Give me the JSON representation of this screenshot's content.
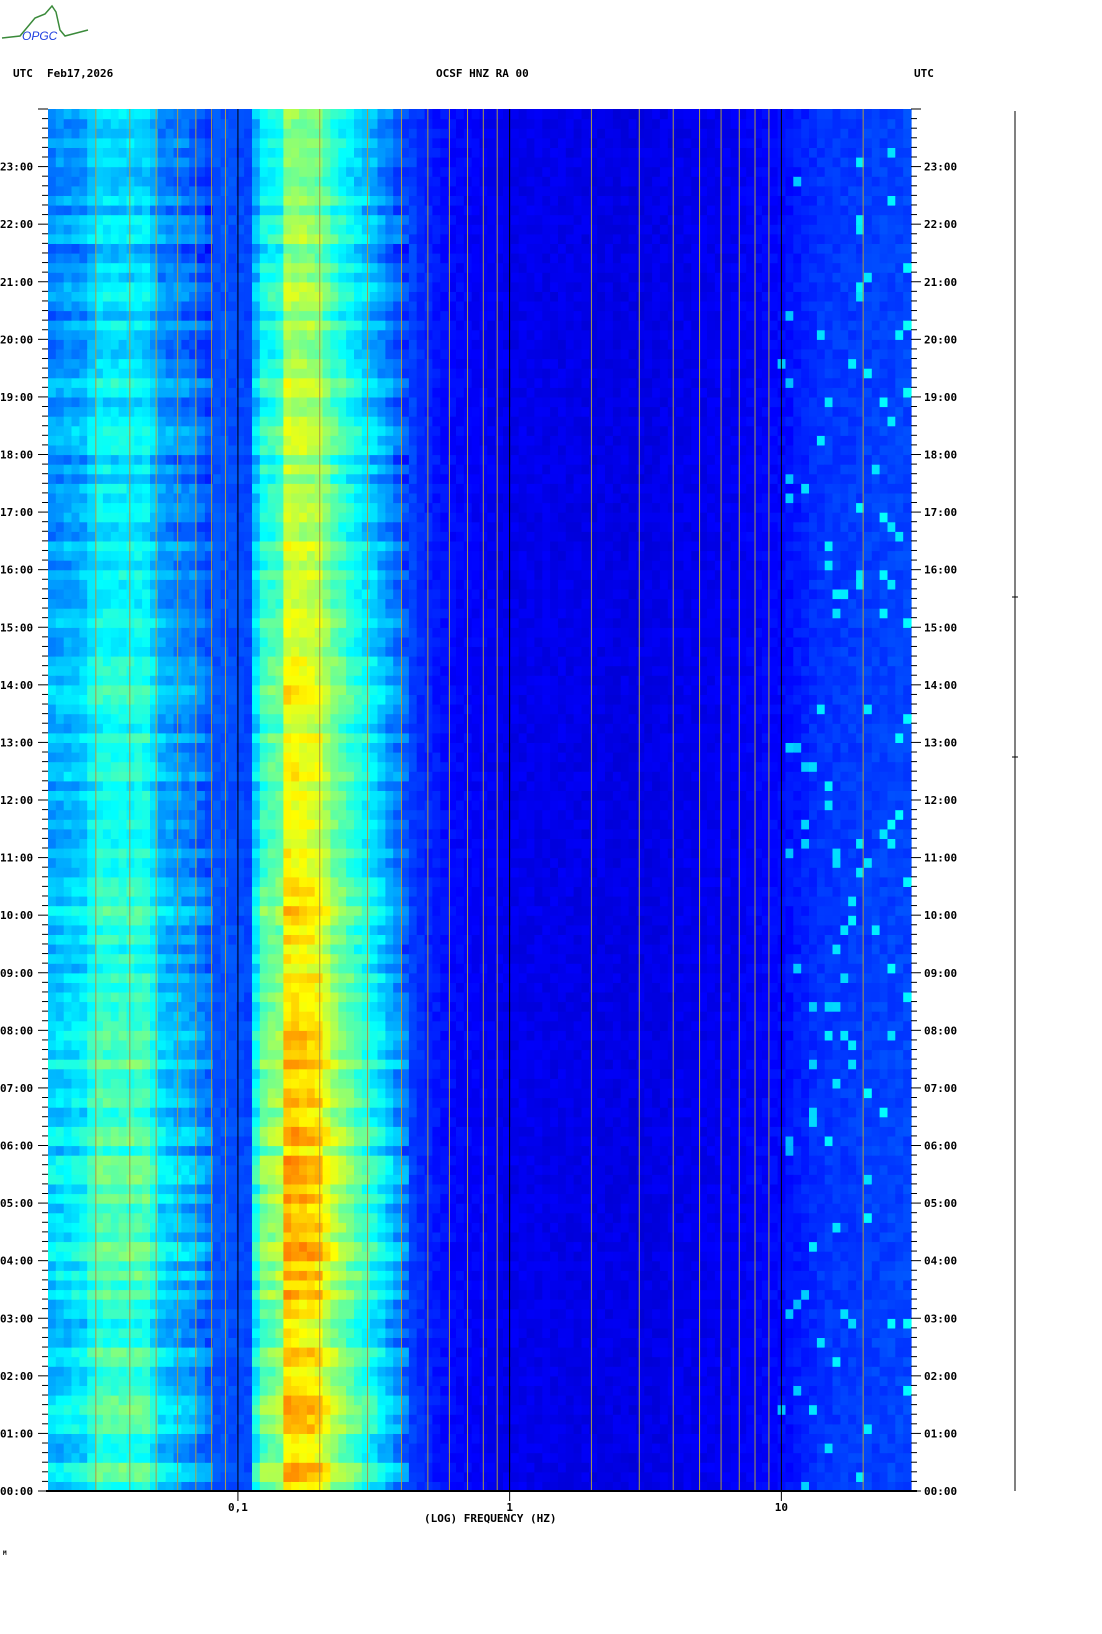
{
  "header": {
    "left_tz": "UTC",
    "date": "Feb17,2026",
    "station": "OCSF HNZ RA 00",
    "right_tz": "UTC",
    "logo_text": "OPGC"
  },
  "footer_mark": "M",
  "chart_data": {
    "type": "heatmap",
    "title": "OCSF HNZ RA 00",
    "xlabel": "(LOG) FREQUENCY (HZ)",
    "ylabel": "UTC",
    "x_scale": "log",
    "xlim": [
      0.02,
      30
    ],
    "x_ticks": [
      {
        "value": 0.1,
        "label": "0,1"
      },
      {
        "value": 1,
        "label": "1"
      },
      {
        "value": 10,
        "label": "10"
      }
    ],
    "ylim": [
      0,
      24
    ],
    "y_ticks": [
      "00:00",
      "01:00",
      "02:00",
      "03:00",
      "04:00",
      "05:00",
      "06:00",
      "07:00",
      "08:00",
      "09:00",
      "10:00",
      "11:00",
      "12:00",
      "13:00",
      "14:00",
      "15:00",
      "16:00",
      "17:00",
      "18:00",
      "19:00",
      "20:00",
      "21:00",
      "22:00",
      "23:00"
    ],
    "grid": true,
    "colormap": [
      "#00008c",
      "#0000ff",
      "#0080ff",
      "#00ffff",
      "#80ff80",
      "#ffff00",
      "#ff8000",
      "#ff0000"
    ],
    "band_profile": [
      [
        0.02,
        0.34
      ],
      [
        0.027,
        0.38
      ],
      [
        0.03,
        0.46
      ],
      [
        0.048,
        0.46
      ],
      [
        0.05,
        0.36
      ],
      [
        0.07,
        0.3
      ],
      [
        0.08,
        0.24
      ],
      [
        0.11,
        0.22
      ],
      [
        0.12,
        0.5
      ],
      [
        0.145,
        0.55
      ],
      [
        0.15,
        0.72
      ],
      [
        0.2,
        0.68
      ],
      [
        0.22,
        0.58
      ],
      [
        0.27,
        0.48
      ],
      [
        0.32,
        0.4
      ],
      [
        0.38,
        0.3
      ],
      [
        0.45,
        0.2
      ],
      [
        0.6,
        0.15
      ],
      [
        1,
        0.12
      ],
      [
        3,
        0.11
      ],
      [
        7,
        0.13
      ],
      [
        10,
        0.15
      ],
      [
        14,
        0.2
      ],
      [
        30,
        0.22
      ]
    ],
    "hourly_factor": [
      1.1,
      1.1,
      1.05,
      1.1,
      1.12,
      1.1,
      1.1,
      1.1,
      1.05,
      1.05,
      1.05,
      1.02,
      1.0,
      0.97,
      0.97,
      0.95,
      0.95,
      0.9,
      0.9,
      0.9,
      0.88,
      0.85,
      0.82,
      0.78
    ]
  }
}
